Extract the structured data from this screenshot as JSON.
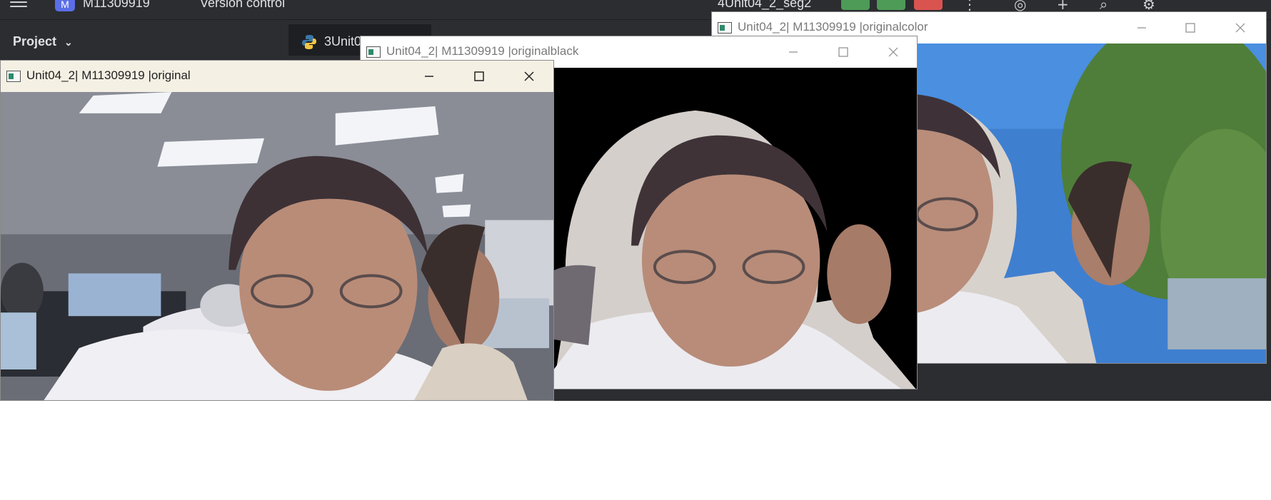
{
  "ide": {
    "project_badge": "M",
    "project_name": "M11309919",
    "version_control": "Version control",
    "run_config": "4Unit04_2_seg2",
    "project_label": "Project",
    "editor_tab": "3Unit0"
  },
  "windows": {
    "original": {
      "title": "Unit04_2| M11309919 |original"
    },
    "originalblack": {
      "title": "Unit04_2| M11309919 |originalblack"
    },
    "originalcolor": {
      "title": "Unit04_2| M11309919 |originalcolor"
    }
  },
  "colors": {
    "ide_bg": "#2b2d30",
    "run_green": "#4e9a57",
    "stop_red": "#d9534f",
    "active_titlebar": "#f4f0e4"
  }
}
